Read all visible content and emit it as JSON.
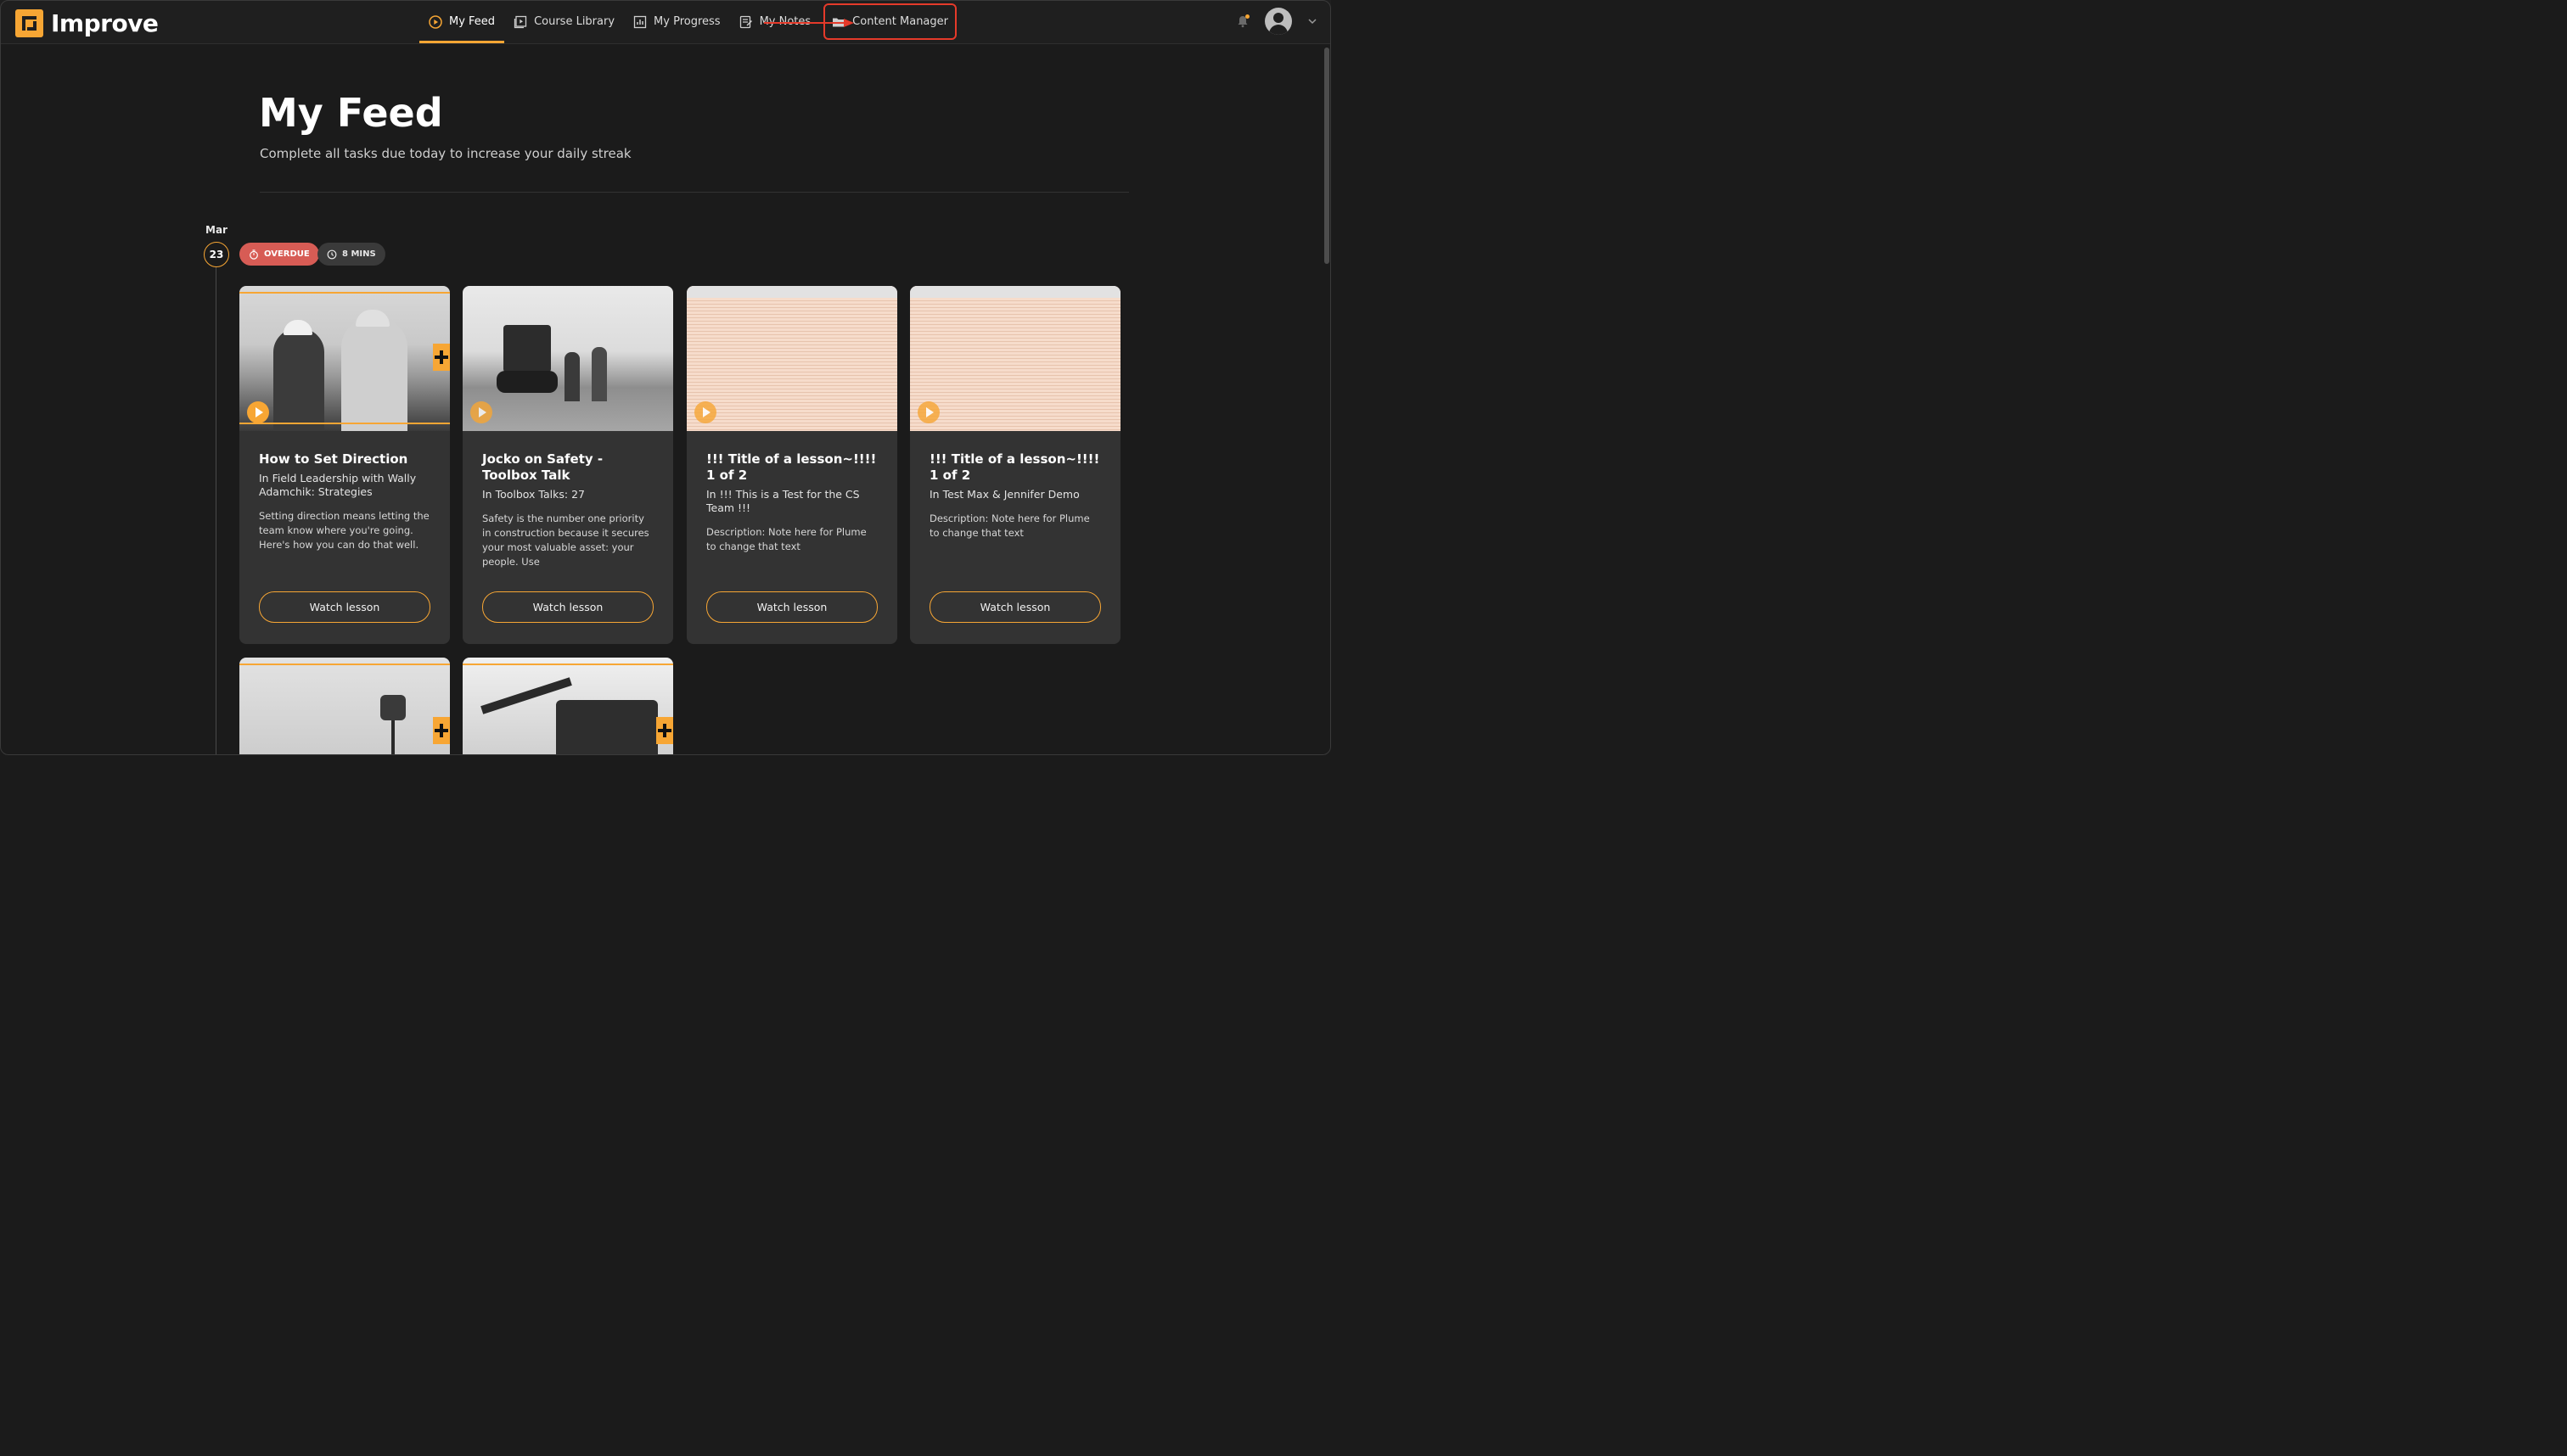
{
  "app": {
    "name": "Improve"
  },
  "nav": {
    "items": [
      {
        "label": "My Feed",
        "icon": "play-circle-icon",
        "active": true
      },
      {
        "label": "Course Library",
        "icon": "library-icon"
      },
      {
        "label": "My Progress",
        "icon": "chart-icon"
      },
      {
        "label": "My Notes",
        "icon": "notes-icon"
      },
      {
        "label": "Content Manager",
        "icon": "folder-icon",
        "highlighted": true
      }
    ]
  },
  "header": {
    "title": "My Feed",
    "subtitle": "Complete all tasks due today to increase your daily streak"
  },
  "feed": {
    "date": {
      "month": "Mar",
      "day": "23"
    },
    "badges": {
      "overdue": "OVERDUE",
      "duration": "8 MINS"
    },
    "cards": [
      {
        "title": "How to Set Direction",
        "course": "In Field Leadership with Wally Adamchik: Strategies",
        "description": "Setting direction means letting the team know where you're going. Here's how you can do that well.",
        "button": "Watch lesson"
      },
      {
        "title": "Jocko on Safety - Toolbox Talk",
        "course": "In Toolbox Talks: 27",
        "description": "Safety is the number one priority in construction because it secures your most valuable asset: your people. Use",
        "button": "Watch lesson"
      },
      {
        "title": "!!! Title of a lesson~!!!! 1 of 2",
        "course": "In !!! This is a Test for the CS Team !!!",
        "description": "Description: Note here for Plume to change that text",
        "button": "Watch lesson"
      },
      {
        "title": "!!! Title of a lesson~!!!! 1 of 2",
        "course": "In Test Max & Jennifer Demo",
        "description": "Description: Note here for Plume to change that text",
        "button": "Watch lesson"
      }
    ]
  },
  "colors": {
    "accent": "#f7a634",
    "overdue": "#d75c55",
    "card": "#333333",
    "background": "#1b1b1b",
    "annotation": "#e53a2a"
  }
}
